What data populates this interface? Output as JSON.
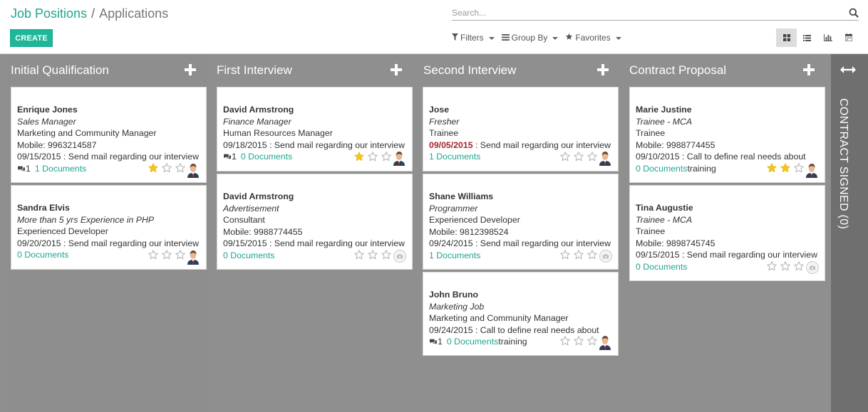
{
  "breadcrumb": {
    "parent": "Job Positions",
    "separator": "/",
    "current": "Applications"
  },
  "toolbar": {
    "create_label": "CREATE"
  },
  "search": {
    "placeholder": "Search..."
  },
  "search_options": {
    "filters": "Filters",
    "group_by": "Group By",
    "favorites": "Favorites"
  },
  "views": [
    "kanban-icon",
    "list-icon",
    "graph-icon",
    "calendar-icon"
  ],
  "colors": {
    "accent": "#1fa591",
    "create": "#1fb79a",
    "star_on": "#f5c518",
    "column_bg": "#8f8f8f",
    "folded_bg": "#6f6f6f",
    "overdue": "#a5262a"
  },
  "columns": [
    {
      "title": "Initial Qualification",
      "cards": [
        {
          "name": "Enrique Jones",
          "job": "Sales Manager",
          "role": "Marketing and Community Manager",
          "mobile": "Mobile: 9963214587",
          "activity": "09/15/2015 : Send mail regarding our interview",
          "messages": "1",
          "docs": "1 Documents",
          "suffix": "",
          "stars": 1
        },
        {
          "name": "Sandra Elvis",
          "job": "More than 5 yrs Experience in PHP",
          "role": "Experienced Developer",
          "activity": "09/20/2015 : Send mail regarding our interview",
          "docs": "0 Documents",
          "suffix": "",
          "stars": 0
        }
      ]
    },
    {
      "title": "First Interview",
      "cards": [
        {
          "name": "David Armstrong",
          "job": "Finance Manager",
          "role": "Human Resources Manager",
          "activity": "09/18/2015 : Send mail regarding our interview",
          "messages": "1",
          "docs": "0 Documents",
          "suffix": "",
          "stars": 1
        },
        {
          "name": "David Armstrong",
          "job": "Advertisement",
          "role": "Consultant",
          "mobile": "Mobile: 9988774455",
          "activity": "09/15/2015 : Send mail regarding our interview",
          "docs": "0 Documents",
          "suffix": "",
          "stars": 0
        }
      ]
    },
    {
      "title": "Second Interview",
      "cards": [
        {
          "name": "Jose",
          "job": "Fresher",
          "role": "Trainee",
          "activity_date": "09/05/2015",
          "activity_text": " : Send mail regarding our interview",
          "docs": "1 Documents",
          "suffix": "",
          "stars": 0
        },
        {
          "name": "Shane Williams",
          "job": "Programmer",
          "role": "Experienced Developer",
          "mobile": "Mobile: 9812398524",
          "activity": "09/24/2015 : Send mail regarding our interview",
          "docs": "1 Documents",
          "suffix": "",
          "stars": 0
        },
        {
          "name": "John Bruno",
          "job": "Marketing Job",
          "role": "Marketing and Community Manager",
          "activity": "09/24/2015 : Call to define real needs about",
          "messages": "1",
          "docs": "0 Documents",
          "suffix": "training",
          "stars": 0
        }
      ]
    },
    {
      "title": "Contract Proposal",
      "cards": [
        {
          "name": "Marie Justine",
          "job": "Trainee - MCA",
          "role": "Trainee",
          "mobile": "Mobile: 9988774455",
          "activity": "09/10/2015 : Call to define real needs about",
          "docs": "0 Documents",
          "suffix": "training",
          "stars": 2
        },
        {
          "name": "Tina Augustie",
          "job": "Trainee - MCA",
          "role": "Trainee",
          "mobile": "Mobile: 9898745745",
          "activity": "09/15/2015 : Send mail regarding our interview",
          "docs": "0 Documents",
          "suffix": "",
          "stars": 0
        }
      ]
    }
  ],
  "folded_column": {
    "title": "CONTRACT SIGNED (0)"
  }
}
